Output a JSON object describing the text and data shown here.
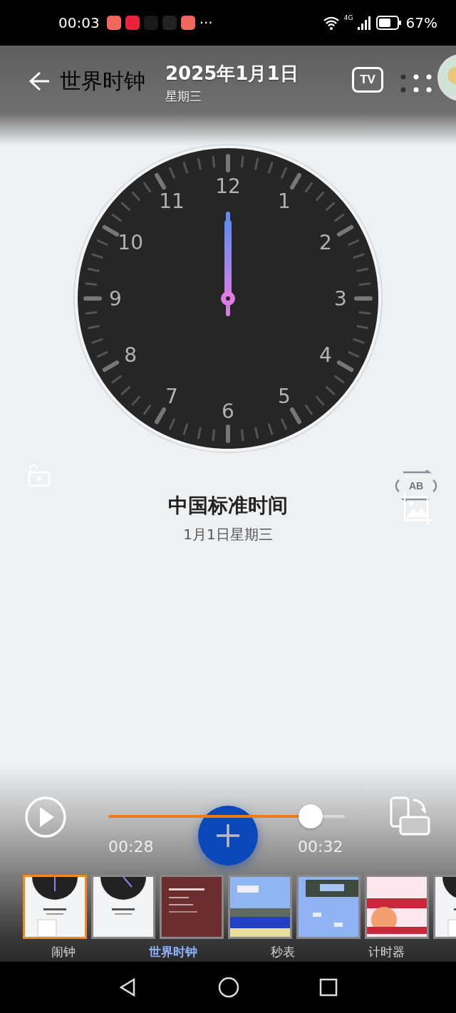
{
  "status_bar": {
    "time": "00:03",
    "overflow": "···",
    "network": "4G",
    "battery": "67%"
  },
  "screen": {
    "title": "世界时钟",
    "city": "中国标准时间",
    "date": "1月1日星期三",
    "clock": {
      "numerals": [
        "12",
        "1",
        "2",
        "3",
        "4",
        "5",
        "6",
        "7",
        "8",
        "9",
        "10",
        "11"
      ]
    },
    "tabs": [
      {
        "label": "闹钟",
        "selected": false
      },
      {
        "label": "世界时钟",
        "selected": true
      },
      {
        "label": "秒表",
        "selected": false
      },
      {
        "label": "计时器",
        "selected": false
      }
    ]
  },
  "viewer": {
    "date": "2025年1月1日",
    "weekday": "星期三",
    "tv_label": "TV",
    "ab_label": "AB",
    "player": {
      "playing": false,
      "level": 0.855,
      "elapsed": "00:28",
      "total": "00:32"
    },
    "thumbnails": [
      {
        "kind": "picture",
        "selected": true
      },
      {
        "kind": "picture",
        "selected": false
      },
      {
        "kind": "picture",
        "selected": false
      },
      {
        "kind": "picture",
        "selected": false
      },
      {
        "kind": "picture",
        "selected": false
      },
      {
        "kind": "picture",
        "selected": false
      },
      {
        "kind": "picture",
        "selected": false
      }
    ]
  }
}
